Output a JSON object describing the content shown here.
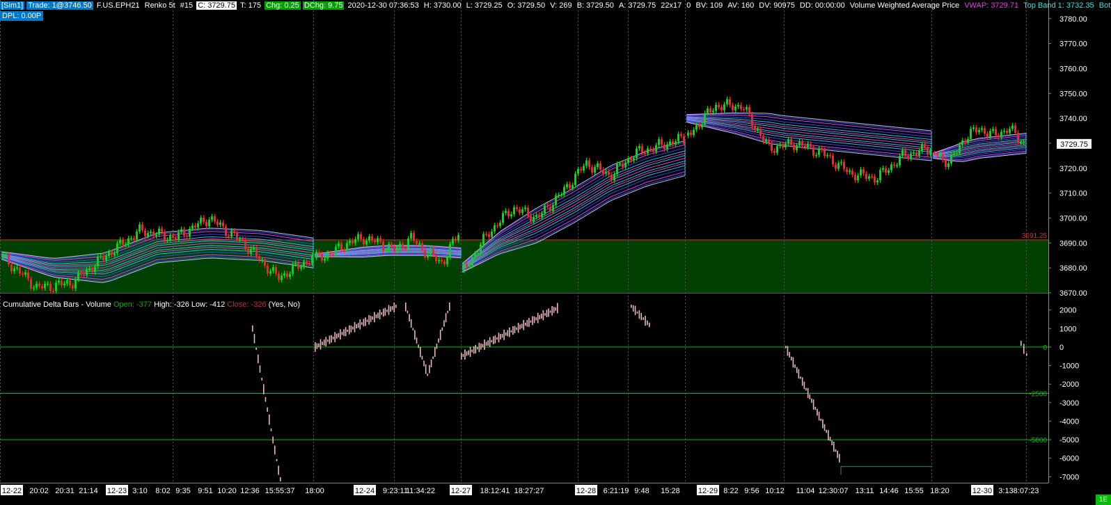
{
  "header": {
    "account": "[Sim1]",
    "trade": "Trade: 1@3746.50",
    "symbol": "F.US.EPH21",
    "bar_type": "Renko 5t",
    "bar_num": "#15",
    "close": "C: 3729.75",
    "ticks": "T: 175",
    "chg": "Chg: 0.25",
    "dchg": "DChg: 9.75",
    "datetime": "2020-12-30 07:36:53",
    "high": "H: 3730.00",
    "low": "L: 3729.25",
    "open": "O: 3729.50",
    "volume": "V: 269",
    "bid": "B: 3729.50",
    "ask": "A: 3729.75",
    "sizes": "22x17",
    "zero": "0",
    "bv": "BV: 109",
    "av": "AV: 160",
    "dv": "DV: 90975",
    "dd": "DD: 00:00:00",
    "study": "Volume Weighted Average Price",
    "vwap": "VWAP: 3729.71",
    "top_band": "Top Band 1: 3732.35",
    "truncated": "Botto"
  },
  "dpl": "DPL: 0.00P",
  "indicator": {
    "name": "Cumulative Delta Bars - Volume",
    "open": "Open: -377",
    "high": "High: -326",
    "low": "Low: -412",
    "close": "Close: -326",
    "flags": "(Yes, No)"
  },
  "badge": "1E",
  "colors": {
    "up": "#00e000",
    "down": "#ff2020",
    "band_outer": "#c8c8c8",
    "band_blue": "#2848ff",
    "band_cyan": "#20c8e0",
    "vwap": "#e040e0",
    "zone_fill": "#004000",
    "zone_line": "#d03030",
    "delta": "#e8b8b8",
    "level_line": "#00c000"
  },
  "chart_data": [
    {
      "type": "candlestick",
      "title": "",
      "ylim": [
        3670,
        3783
      ],
      "y_ticks": [
        "3780.00",
        "3770.00",
        "3760.00",
        "3750.00",
        "3740.00",
        "3730.00",
        "3720.00",
        "3710.00",
        "3700.00",
        "3690.00",
        "3680.00",
        "3670.00"
      ],
      "current_price": "3729.75",
      "zone": {
        "low": 3670,
        "high": 3691.25,
        "label": "3691.25"
      },
      "sessions": [
        {
          "vwap": [
            3685,
            3680,
            3680,
            3688,
            3690,
            3689,
            3686
          ],
          "w": 6,
          "close": [
            3684,
            3672,
            3674,
            3685,
            3695,
            3692,
            3700,
            3690,
            3676,
            3684
          ]
        },
        {
          "vwap": [
            3685,
            3686,
            3687,
            3687,
            3686
          ],
          "w": 2,
          "close": [
            3684,
            3686,
            3690,
            3692,
            3690,
            3687,
            3692,
            3686,
            3682,
            3694
          ]
        },
        {
          "vwap": [
            3680,
            3690,
            3697,
            3705,
            3714,
            3720,
            3724
          ],
          "w": 7,
          "close": [
            3679,
            3694,
            3704,
            3700,
            3710,
            3722,
            3717,
            3726,
            3729,
            3732
          ]
        },
        {
          "vwap": [
            3740,
            3738,
            3735,
            3733,
            3731,
            3729
          ],
          "w": 6,
          "close": [
            3733,
            3745,
            3745,
            3728,
            3730,
            3726,
            3718,
            3716,
            3725,
            3728
          ]
        },
        {
          "vwap": [
            3725,
            3726,
            3728,
            3729,
            3730
          ],
          "w": 4,
          "close": [
            3726,
            3722,
            3732,
            3736,
            3733,
            3736,
            3730
          ]
        }
      ]
    },
    {
      "type": "bar",
      "title": "Cumulative Delta Bars - Volume",
      "ylim": [
        -7250,
        2400
      ],
      "y_ticks": [
        "2000",
        "1000",
        "0",
        "-1000",
        "-2000",
        "-3000",
        "-4000",
        "-5000",
        "-6000",
        "-7000"
      ],
      "levels": [
        {
          "value": 0,
          "label": "0"
        },
        {
          "value": -2500,
          "label": "-2500"
        },
        {
          "value": -5000,
          "label": "-5000"
        }
      ],
      "segments": [
        {
          "x": [
            362,
            402
          ],
          "y": [
            1000,
            -7200
          ]
        },
        {
          "x": [
            452,
            568
          ],
          "y": [
            0,
            2200
          ]
        },
        {
          "x": [
            582,
            645
          ],
          "y": [
            2200,
            -1500,
            2200
          ]
        },
        {
          "x": [
            662,
            800
          ],
          "y": [
            -500,
            2100
          ]
        },
        {
          "x": [
            906,
            932
          ],
          "y": [
            2200,
            1200
          ]
        },
        {
          "x": [
            1128,
            1205
          ],
          "y": [
            0,
            -6000
          ]
        },
        {
          "x": [
            1466,
            1474
          ],
          "y": [
            200,
            -400
          ]
        }
      ],
      "flat_line": {
        "x": [
          1208,
          1338
        ],
        "y": -6450
      }
    }
  ],
  "x_axis": [
    {
      "label": "12-22",
      "highlight": true
    },
    {
      "label": "20:02"
    },
    {
      "label": "20:31"
    },
    {
      "label": "21:14"
    },
    {
      "label": "12-23",
      "highlight": true
    },
    {
      "label": "3:10"
    },
    {
      "label": "8:02"
    },
    {
      "label": "9:35"
    },
    {
      "label": "9:51"
    },
    {
      "label": "10:20"
    },
    {
      "label": "12:36"
    },
    {
      "label": "15:55:37"
    },
    {
      "label": "18:00"
    },
    {
      "label": "12-24",
      "highlight": true
    },
    {
      "label": "9:23:11"
    },
    {
      "label": "11:34:22"
    },
    {
      "label": "12-27",
      "highlight": true
    },
    {
      "label": "18:12:41"
    },
    {
      "label": "18:27:27"
    },
    {
      "label": "12-28",
      "highlight": true
    },
    {
      "label": "6:21:19"
    },
    {
      "label": "9:48"
    },
    {
      "label": "15:28"
    },
    {
      "label": "12-29",
      "highlight": true
    },
    {
      "label": "8:22"
    },
    {
      "label": "9:56"
    },
    {
      "label": "10:12"
    },
    {
      "label": "11:04"
    },
    {
      "label": "12:30:07"
    },
    {
      "label": "13:11"
    },
    {
      "label": "14:46"
    },
    {
      "label": "15:55"
    },
    {
      "label": "18:20"
    },
    {
      "label": "12-30",
      "highlight": true
    },
    {
      "label": "3:13"
    },
    {
      "label": "8:07:23"
    }
  ]
}
